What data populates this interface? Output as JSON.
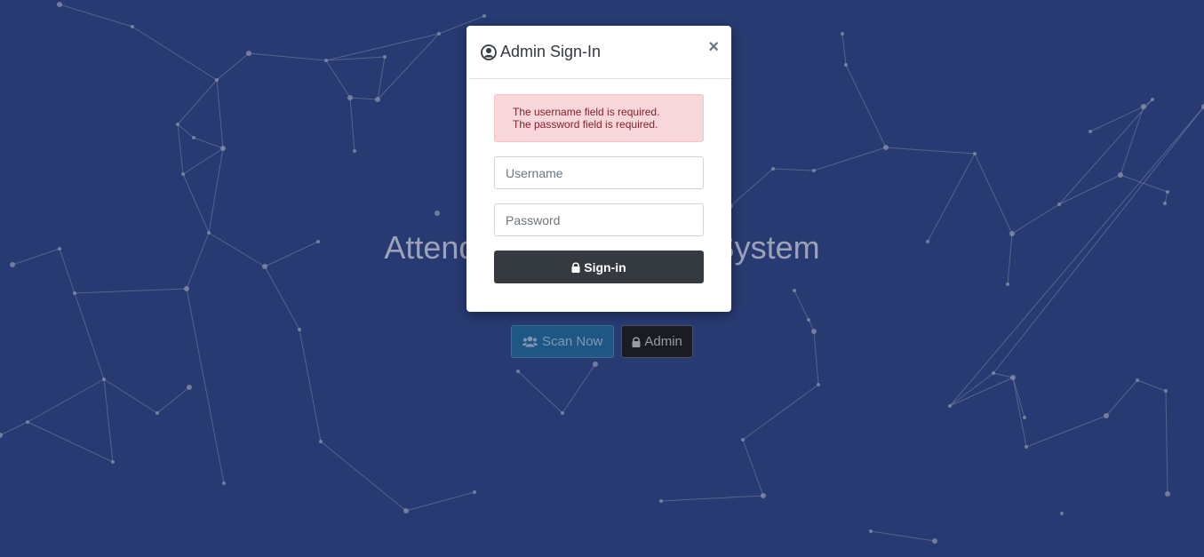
{
  "hero": {
    "title": "Attendance Monitoring System",
    "scan_label": "Scan Now",
    "admin_label": "Admin"
  },
  "modal": {
    "title": "Admin Sign-In",
    "close_glyph": "×",
    "errors": [
      "The username field is required.",
      "The password field is required."
    ],
    "username_placeholder": "Username",
    "password_placeholder": "Password",
    "signin_label": "Sign-in"
  },
  "colors": {
    "background": "#283a72",
    "alert_bg": "#f8d7da",
    "alert_text": "#842029",
    "signin_bg": "#343a40",
    "scan_bg": "#1f5784"
  },
  "icons": {
    "title_icon": "user-circle-icon",
    "signin_icon": "lock-icon",
    "scan_icon": "users-icon",
    "admin_icon": "lock-icon",
    "close_icon": "close-icon"
  }
}
